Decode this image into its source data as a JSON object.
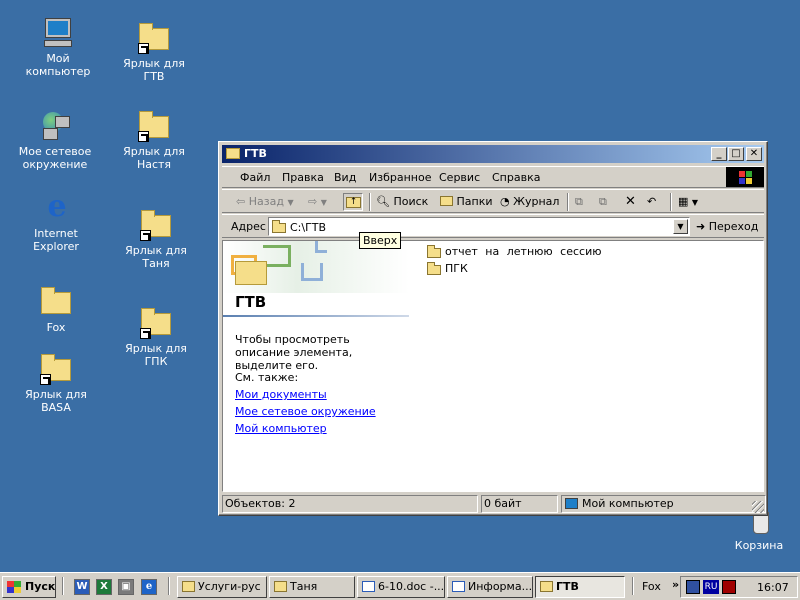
{
  "desktop": {
    "icons": [
      {
        "label": "Мой компьютер"
      },
      {
        "label": "Ярлык для ГТВ"
      },
      {
        "label": "Мое сетевое окружение"
      },
      {
        "label": "Ярлык для Настя"
      },
      {
        "label": "Internet Explorer"
      },
      {
        "label": "Ярлык для Таня"
      },
      {
        "label": "Fox"
      },
      {
        "label": "Ярлык для ГПК"
      },
      {
        "label": "Ярлык для BASA"
      },
      {
        "label": "Корзина"
      }
    ]
  },
  "window": {
    "title": "ГТВ",
    "menu": [
      "Файл",
      "Правка",
      "Вид",
      "Избранное",
      "Сервис",
      "Справка"
    ],
    "toolbar": {
      "back_label": "Назад",
      "search_label": "Поиск",
      "folders_label": "Папки",
      "history_label": "Журнал"
    },
    "address": {
      "label": "Адрес",
      "value": "C:\\ГТВ",
      "go_label": "Переход"
    },
    "tooltip": "Вверх",
    "left_pane": {
      "heading": "ГТВ",
      "description": "Чтобы просмотреть описание элемента, выделите его.",
      "see_also": "См. также:",
      "links": [
        "Мои документы",
        "Мое сетевое окружение",
        "Мой компьютер"
      ]
    },
    "files": [
      {
        "name": "отчет на летнюю сессию"
      },
      {
        "name": "ПГК"
      }
    ],
    "status": {
      "objects": "Объектов: 2",
      "size": "0 байт",
      "zone": "Мой компьютер"
    }
  },
  "taskbar": {
    "start_label": "Пуск",
    "tasks": [
      {
        "label": "Услуги-рус"
      },
      {
        "label": "Таня"
      },
      {
        "label": "6-10.doc -..."
      },
      {
        "label": "Информа..."
      },
      {
        "label": "ГТВ"
      }
    ],
    "quick_launch": [
      "W",
      "X",
      "▣",
      "e"
    ],
    "toolbar_label": "Fox",
    "language": "RU",
    "clock": "16:07"
  }
}
